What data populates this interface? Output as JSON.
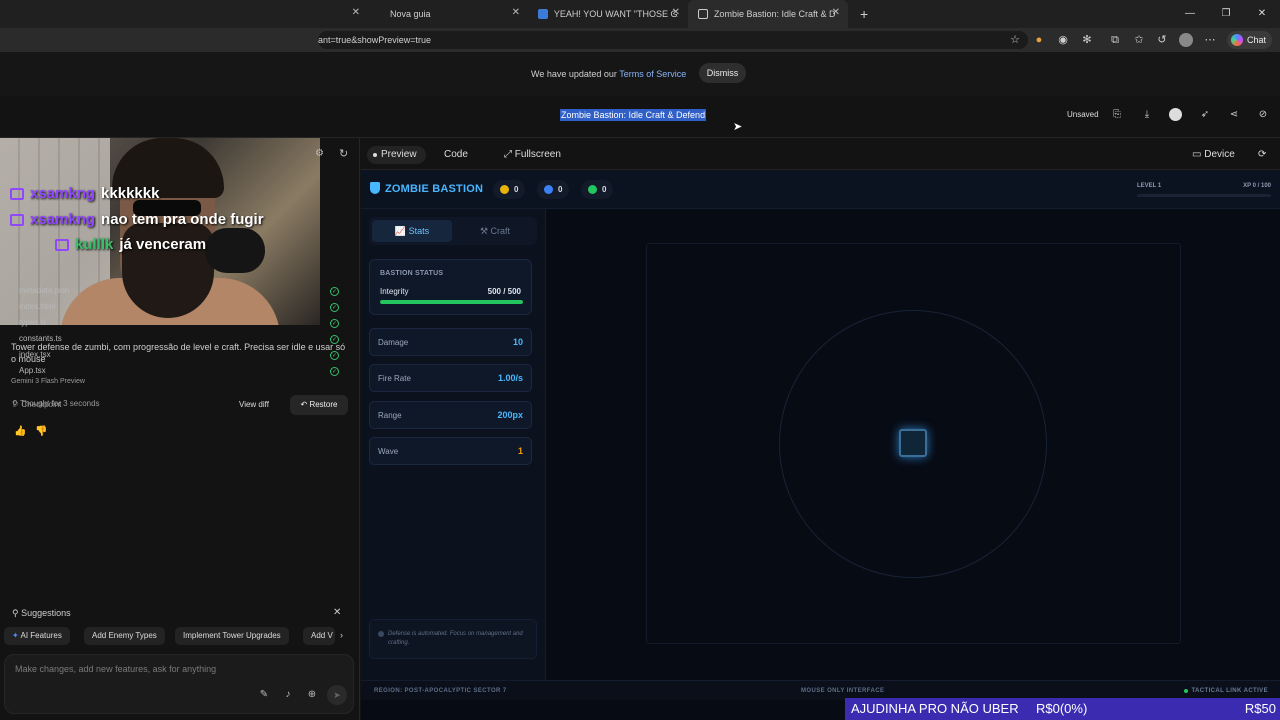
{
  "browser": {
    "tabs": [
      {
        "label": ""
      },
      {
        "label": "Nova guia"
      },
      {
        "label": "YEAH! YOU WANT \"THOSE GAMES\""
      },
      {
        "label": "Zombie Bastion: Idle Craft & D | G"
      }
    ],
    "url": "ant=true&showPreview=true",
    "chat_label": "Chat"
  },
  "notice": {
    "text": "We have updated our ",
    "link": "Terms of Service",
    "dismiss": "Dismiss"
  },
  "header": {
    "title": "Zombie Bastion: Idle Craft & Defend",
    "unsaved": "Unsaved"
  },
  "stream_chat": [
    {
      "user": "xsamkng",
      "message": "kkkkkkk"
    },
    {
      "user": "xsamkng",
      "message": "nao tem pra onde fugir"
    },
    {
      "user": "kulllk",
      "message": "já venceram"
    }
  ],
  "left": {
    "prompt": "Tower defense de zumbi, com progressão de level e craft. Precisa ser idle e usar só o mouse",
    "model": "Gemini 3 Flash Preview",
    "thought": "Thought for 3 seconds",
    "files": [
      "metadata.json",
      "index.html",
      "types.ts",
      "constants.ts",
      "index.tsx",
      "App.tsx"
    ],
    "checkpoint": "Checkpoint",
    "view_diff": "View diff",
    "restore": "Restore",
    "suggestions_title": "Suggestions",
    "chips": [
      "AI Features",
      "Add Enemy Types",
      "Implement Tower Upgrades",
      "Add V"
    ],
    "input_placeholder": "Make changes, add new features, ask for anything"
  },
  "preview_bar": {
    "preview": "Preview",
    "code": "Code",
    "fullscreen": "Fullscreen",
    "device": "Device"
  },
  "game": {
    "title": "ZOMBIE BASTION",
    "resources": [
      {
        "value": "0",
        "color": "#eab308"
      },
      {
        "value": "0",
        "color": "#3b82f6"
      },
      {
        "value": "0",
        "color": "#22c55e"
      }
    ],
    "level": "LEVEL 1",
    "xp": "XP 0 / 100",
    "xp_fraction": 0,
    "tabs": {
      "stats": "Stats",
      "craft": "Craft"
    },
    "status_title": "BASTION STATUS",
    "integrity_label": "Integrity",
    "integrity_value": "500 / 500",
    "integrity_fraction": 1.0,
    "stats": [
      {
        "label": "Damage",
        "value": "10"
      },
      {
        "label": "Fire Rate",
        "value": "1.00/s"
      },
      {
        "label": "Range",
        "value": "200px"
      },
      {
        "label": "Wave",
        "value": "1"
      }
    ],
    "note": "Defense is automated. Focus on management and crafting.",
    "footer": {
      "region": "REGION: POST-APOCALYPTIC SECTOR 7",
      "mouse": "MOUSE ONLY INTERFACE",
      "link": "TACTICAL LINK ACTIVE"
    }
  },
  "donation": {
    "label": "AJUDINHA PRO NÃO UBER",
    "value": "R$0(0%)",
    "goal": "R$50"
  }
}
